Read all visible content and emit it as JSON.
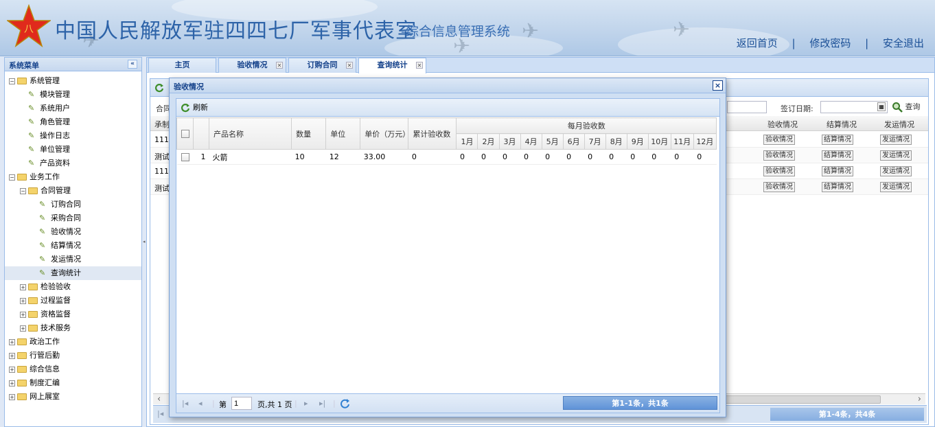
{
  "header": {
    "title": "中国人民解放军驻四四七厂军事代表室",
    "subtitle": "-综合信息管理系统",
    "links": [
      "返回首页",
      "修改密码",
      "安全退出"
    ],
    "separator": "|"
  },
  "sidebar": {
    "title": "系统菜单",
    "collapse_glyph": "«",
    "tree": [
      {
        "label": "系统管理",
        "level": 0,
        "type": "folder",
        "expanded": true
      },
      {
        "label": "模块管理",
        "level": 1,
        "type": "leaf"
      },
      {
        "label": "系统用户",
        "level": 1,
        "type": "leaf"
      },
      {
        "label": "角色管理",
        "level": 1,
        "type": "leaf"
      },
      {
        "label": "操作日志",
        "level": 1,
        "type": "leaf"
      },
      {
        "label": "单位管理",
        "level": 1,
        "type": "leaf"
      },
      {
        "label": "产品资料",
        "level": 1,
        "type": "leaf"
      },
      {
        "label": "业务工作",
        "level": 0,
        "type": "folder",
        "expanded": true
      },
      {
        "label": "合同管理",
        "level": 1,
        "type": "folder",
        "expanded": true
      },
      {
        "label": "订购合同",
        "level": 2,
        "type": "leaf"
      },
      {
        "label": "采购合同",
        "level": 2,
        "type": "leaf"
      },
      {
        "label": "验收情况",
        "level": 2,
        "type": "leaf"
      },
      {
        "label": "结算情况",
        "level": 2,
        "type": "leaf"
      },
      {
        "label": "发运情况",
        "level": 2,
        "type": "leaf"
      },
      {
        "label": "查询统计",
        "level": 2,
        "type": "leaf",
        "selected": true
      },
      {
        "label": "检验验收",
        "level": 1,
        "type": "folder",
        "expanded": false
      },
      {
        "label": "过程监督",
        "level": 1,
        "type": "folder",
        "expanded": false
      },
      {
        "label": "资格监督",
        "level": 1,
        "type": "folder",
        "expanded": false
      },
      {
        "label": "技术服务",
        "level": 1,
        "type": "folder",
        "expanded": false
      },
      {
        "label": "政治工作",
        "level": 0,
        "type": "folder",
        "expanded": false
      },
      {
        "label": "行管后勤",
        "level": 0,
        "type": "folder",
        "expanded": false
      },
      {
        "label": "综合信息",
        "level": 0,
        "type": "folder",
        "expanded": false
      },
      {
        "label": "制度汇编",
        "level": 0,
        "type": "folder",
        "expanded": false
      },
      {
        "label": "网上展室",
        "level": 0,
        "type": "folder",
        "expanded": false
      }
    ]
  },
  "tabs": [
    {
      "label": "主页",
      "closable": false,
      "active": false
    },
    {
      "label": "验收情况",
      "closable": true,
      "active": false
    },
    {
      "label": "订购合同",
      "closable": true,
      "active": false
    },
    {
      "label": "查询统计",
      "closable": true,
      "active": true
    }
  ],
  "background": {
    "toolbar": {
      "left_label": "合同",
      "date_label": "签订日期:",
      "search_label": "查询"
    },
    "grid_headers": [
      "承制",
      "验收情况",
      "结算情况",
      "发运情况"
    ],
    "rows": [
      {
        "first": "111",
        "buttons": [
          "验收情况",
          "结算情况",
          "发运情况"
        ]
      },
      {
        "first": "测试",
        "buttons": [
          "验收情况",
          "结算情况",
          "发运情况"
        ]
      },
      {
        "first": "111",
        "buttons": [
          "验收情况",
          "结算情况",
          "发运情况"
        ]
      },
      {
        "first": "测试",
        "buttons": [
          "验收情况",
          "结算情况",
          "发运情况"
        ]
      }
    ],
    "pager_info": "第1-4条，共4条"
  },
  "modal": {
    "title": "验收情况",
    "close_glyph": "×",
    "toolbar_refresh": "刷新",
    "columns": {
      "name": "产品名称",
      "qty": "数量",
      "unit": "单位",
      "price": "单价（万元）",
      "total": "累计验收数",
      "monthly_group": "每月验收数",
      "months": [
        "1月",
        "2月",
        "3月",
        "4月",
        "5月",
        "6月",
        "7月",
        "8月",
        "9月",
        "10月",
        "11月",
        "12月"
      ]
    },
    "rows": [
      {
        "index": "1",
        "name": "火箭",
        "qty": "10",
        "unit": "12",
        "price": "33.00",
        "total": "0",
        "months": [
          "0",
          "0",
          "0",
          "0",
          "0",
          "0",
          "0",
          "0",
          "0",
          "0",
          "0",
          "0"
        ]
      }
    ],
    "pager": {
      "page_prefix": "第",
      "page_value": "1",
      "page_suffix": "页,共 1 页",
      "info": "第1-1条，共1条"
    }
  }
}
